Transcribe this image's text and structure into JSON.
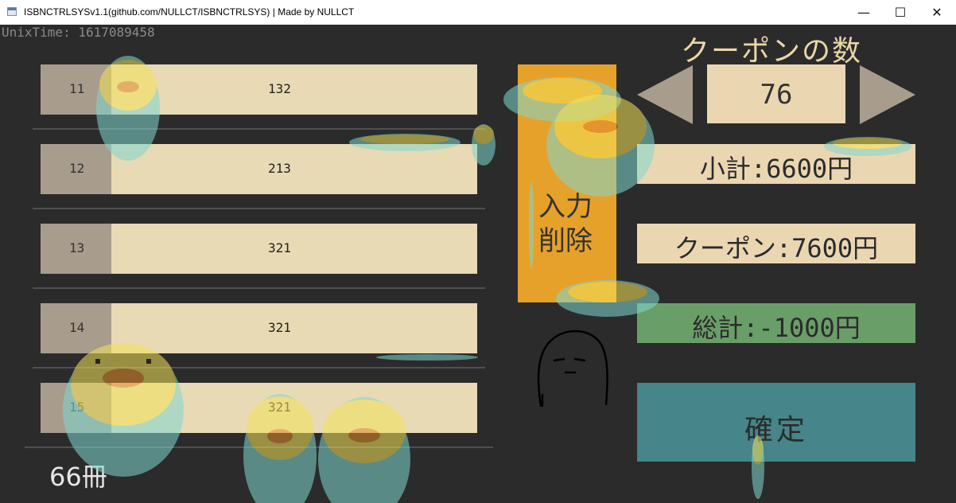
{
  "window": {
    "title": "ISBNCTRLSYSv1.1(github.com/NULLCT/ISBNCTRLSYS) | Made by NULLCT",
    "minimize": "—",
    "maximize": "☐",
    "close": "✕"
  },
  "app": {
    "unix_time": "UnixTime: 1617089458",
    "rows": [
      {
        "index": "11",
        "value": "132"
      },
      {
        "index": "12",
        "value": "213"
      },
      {
        "index": "13",
        "value": "321"
      },
      {
        "index": "14",
        "value": "321"
      },
      {
        "index": "15",
        "value": "321"
      }
    ],
    "book_count": "66冊",
    "input_delete_label": "入力\n削除",
    "coupon_title": "クーポンの数",
    "coupon_value": "76",
    "subtotal": "小計:6600円",
    "coupon_amount": "クーポン:7600円",
    "total": "総計:-1000円",
    "confirm_label": "確定"
  },
  "colors": {
    "background": "#2b2b2b",
    "row_bg": "#e8dab4",
    "row_index_bg": "#a89c8c",
    "input_delete_bg": "#e6a12a",
    "subtotal_bg": "#ead7b2",
    "coupon_bg": "#ead7b2",
    "total_bg": "#6a9e68",
    "confirm_bg": "#468589",
    "coupon_title_color": "#ead7a8"
  },
  "icons": {
    "app": "window-app-icon",
    "prev": "triangle-left-icon",
    "next": "triangle-right-icon",
    "character": "line-drawn-character",
    "stickers": "bird-mascot-sticker"
  }
}
